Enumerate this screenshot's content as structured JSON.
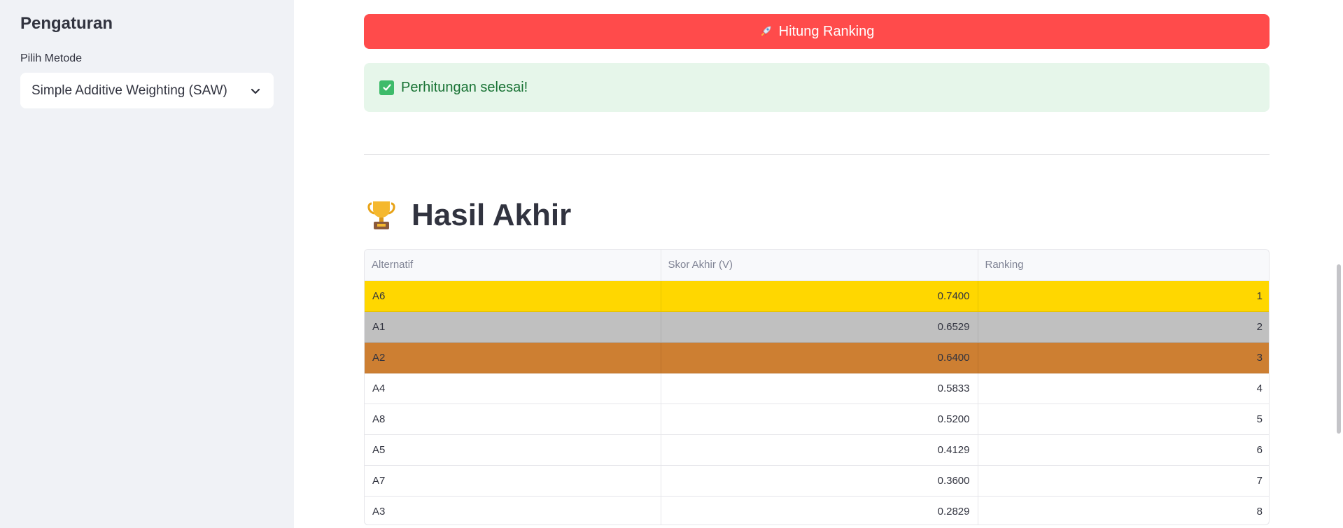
{
  "sidebar": {
    "title": "Pengaturan",
    "method_label": "Pilih Metode",
    "method_value": "Simple Additive Weighting (SAW)"
  },
  "main": {
    "button_label": "Hitung Ranking",
    "success_message": "Perhitungan selesai!",
    "result_title": "Hasil Akhir",
    "table": {
      "headers": [
        "Alternatif",
        "Skor Akhir (V)",
        "Ranking"
      ],
      "rows": [
        {
          "alternatif": "A6",
          "skor": "0.7400",
          "ranking": "1"
        },
        {
          "alternatif": "A1",
          "skor": "0.6529",
          "ranking": "2"
        },
        {
          "alternatif": "A2",
          "skor": "0.6400",
          "ranking": "3"
        },
        {
          "alternatif": "A4",
          "skor": "0.5833",
          "ranking": "4"
        },
        {
          "alternatif": "A8",
          "skor": "0.5200",
          "ranking": "5"
        },
        {
          "alternatif": "A5",
          "skor": "0.4129",
          "ranking": "6"
        },
        {
          "alternatif": "A7",
          "skor": "0.3600",
          "ranking": "7"
        },
        {
          "alternatif": "A3",
          "skor": "0.2829",
          "ranking": "8"
        }
      ]
    }
  },
  "icons": {
    "button_icon": "rocket-icon",
    "success_icon": "check-icon",
    "title_icon": "trophy-icon",
    "select_icon": "chevron-down-icon"
  },
  "colors": {
    "primary": "#ff4b4b",
    "success_bg": "#e6f6ea",
    "success_text": "#177233",
    "rank1": "#ffd700",
    "rank2": "#c0c0c0",
    "rank3": "#cd7f32"
  }
}
